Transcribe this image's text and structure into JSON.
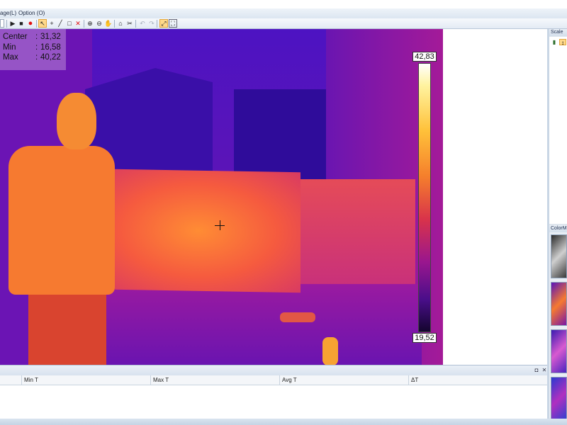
{
  "menu": {
    "items": [
      {
        "label": "age(L)"
      },
      {
        "label": "Option (O)"
      }
    ]
  },
  "toolbar": {
    "icons": [
      "play-icon",
      "stop-icon",
      "record-icon",
      "select-pointer-icon",
      "point-tool-icon",
      "line-tool-icon",
      "rectangle-tool-icon",
      "delete-icon",
      "zoom-in-icon",
      "zoom-out-icon",
      "pan-hand-icon",
      "home-icon",
      "tools-icon",
      "undo-icon",
      "redo-icon",
      "fit-window-icon",
      "full-size-icon"
    ]
  },
  "readout": {
    "rows": [
      {
        "label": "Center",
        "value": "31,32"
      },
      {
        "label": "Min",
        "value": "16,58"
      },
      {
        "label": "Max",
        "value": "40,22"
      }
    ],
    "separator": ":"
  },
  "scale": {
    "max": "42,83",
    "min": "19,52"
  },
  "panels": {
    "scale_title": "Scale",
    "colormap_title": "ColorM"
  },
  "table": {
    "columns": [
      "Min T",
      "Max T",
      "Avg T",
      "ΔT"
    ]
  },
  "colors": {
    "accent": "#ffd98a",
    "frame": "#dfe6ee"
  }
}
